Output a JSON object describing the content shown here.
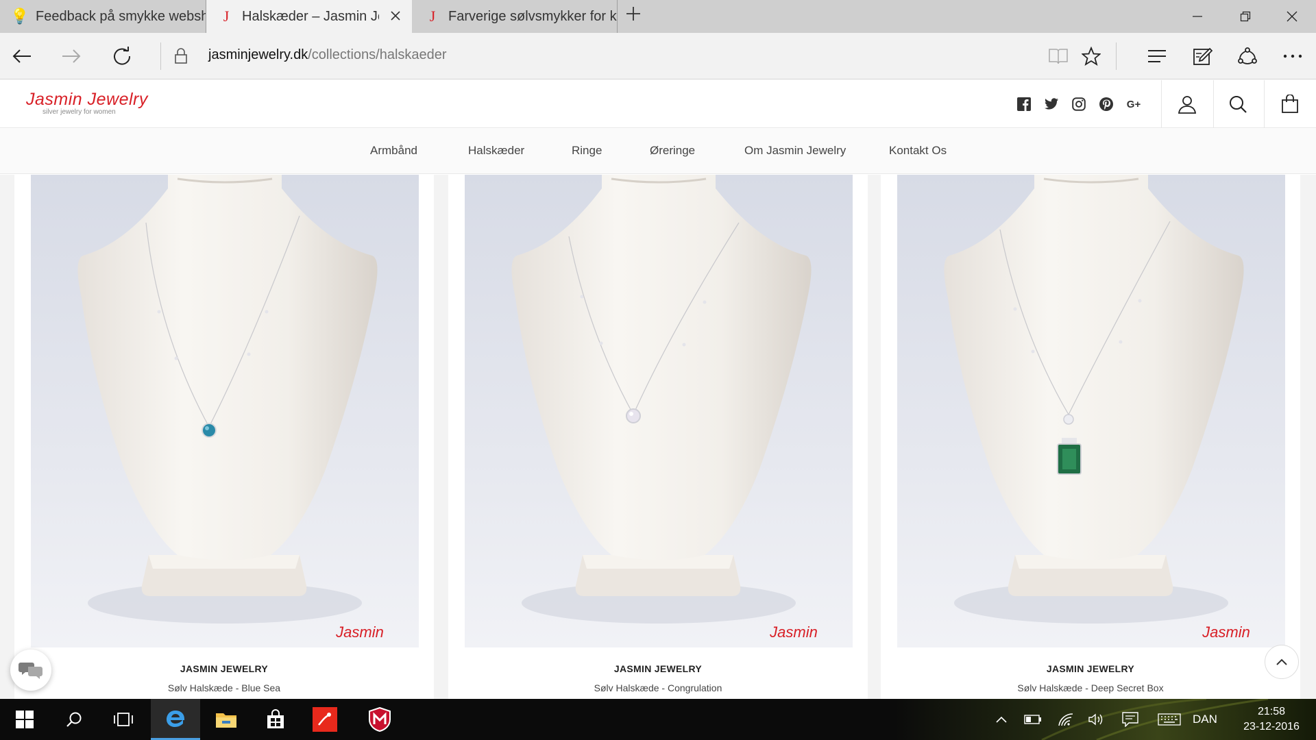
{
  "browser": {
    "tabs": [
      {
        "title": "Feedback på smykke websh",
        "favicon": "lightbulb-icon",
        "active": false
      },
      {
        "title": "Halskæder – Jasmin Jew",
        "favicon": "jasmin-j-icon",
        "active": true
      },
      {
        "title": "Farverige sølvsmykker for kv",
        "favicon": "jasmin-j-icon",
        "active": false
      }
    ],
    "url_host": "jasminjewelry.dk",
    "url_path": "/collections/halskaeder"
  },
  "site": {
    "logo_name": "Jasmin Jewelry",
    "logo_tagline": "silver jewelry for women",
    "social": [
      "facebook-icon",
      "twitter-icon",
      "instagram-icon",
      "pinterest-icon",
      "google-plus-icon"
    ],
    "google_plus_label": "G+",
    "nav": [
      "Armbånd",
      "Halskæder",
      "Ringe",
      "Øreringe",
      "Om Jasmin Jewelry",
      "Kontakt Os"
    ],
    "accent_color": "#d81f26"
  },
  "products": [
    {
      "brand": "JASMIN JEWELRY",
      "name": "Sølv Halskæde - Blue Sea",
      "stone_color": "#2a8aa8",
      "watermark": "Jasmin"
    },
    {
      "brand": "JASMIN JEWELRY",
      "name": "Sølv Halskæde - Congrulation",
      "stone_color": "#e8e4ee",
      "watermark": "Jasmin"
    },
    {
      "brand": "JASMIN JEWELRY",
      "name": "Sølv Halskæde - Deep Secret Box",
      "stone_color": "#1f6e45",
      "watermark": "Jasmin"
    }
  ],
  "taskbar": {
    "language": "DAN",
    "time": "21:58",
    "date": "23-12-2016"
  }
}
